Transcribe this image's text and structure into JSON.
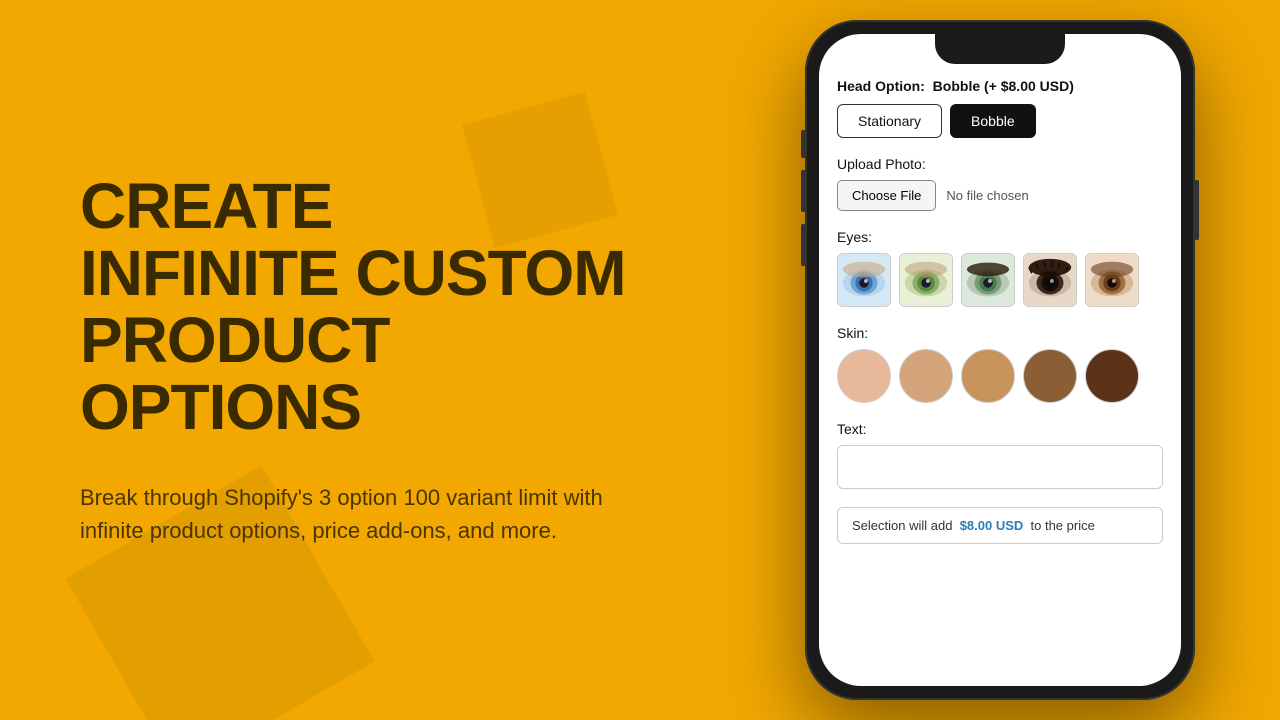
{
  "left": {
    "headline_line1": "CREATE",
    "headline_line2": "INFINITE CUSTOM",
    "headline_line3": "PRODUCT OPTIONS",
    "subtext": "Break through Shopify's 3 option 100 variant limit with infinite product options, price add-ons, and more."
  },
  "phone": {
    "head_option_label": "Head Option:",
    "head_option_value": "Bobble (+ $8.00 USD)",
    "buttons": [
      {
        "label": "Stationary",
        "active": false
      },
      {
        "label": "Bobble",
        "active": true
      }
    ],
    "upload_label": "Upload Photo:",
    "choose_file_label": "Choose File",
    "no_file_text": "No file chosen",
    "eyes_label": "Eyes:",
    "eyes": [
      {
        "color": "#5B8ED6",
        "label": "blue eye"
      },
      {
        "color": "#7A9E5F",
        "label": "green eye"
      },
      {
        "color": "#6B8E6B",
        "label": "gray-green eye"
      },
      {
        "color": "#1a1a1a",
        "label": "dark eye"
      },
      {
        "color": "#8B5E3C",
        "label": "brown eye"
      }
    ],
    "skin_label": "Skin:",
    "skin_colors": [
      "#E8B89A",
      "#D4A47A",
      "#C8935A",
      "#8B5E35",
      "#5C3318"
    ],
    "text_label": "Text:",
    "text_placeholder": "",
    "price_notice_pre": "Selection will add",
    "price_notice_price": "$8.00 USD",
    "price_notice_post": "to the price"
  }
}
